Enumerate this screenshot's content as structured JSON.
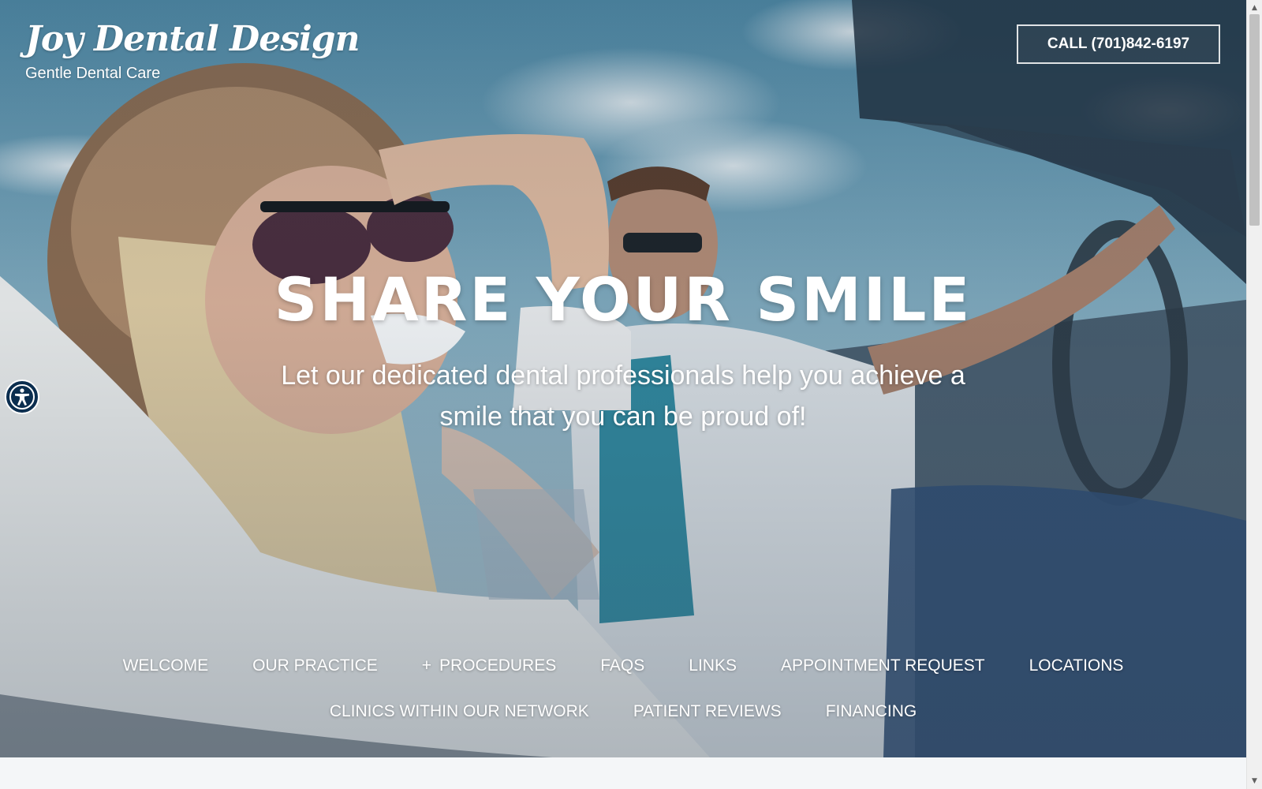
{
  "header": {
    "brand_name": "Joy Dental Design",
    "brand_tagline": "Gentle Dental Care",
    "call_button": "CALL (701)842-6197"
  },
  "hero": {
    "headline": "SHARE YOUR SMILE",
    "subhead": "Let our dedicated dental professionals help you achieve a smile that you can be proud of!"
  },
  "nav": {
    "row1": [
      {
        "label": "WELCOME"
      },
      {
        "label": "OUR PRACTICE"
      },
      {
        "label": "PROCEDURES",
        "prefix": "+"
      },
      {
        "label": "FAQS"
      },
      {
        "label": "LINKS"
      },
      {
        "label": "APPOINTMENT REQUEST"
      },
      {
        "label": "LOCATIONS"
      }
    ],
    "row2": [
      {
        "label": "CLINICS WITHIN OUR NETWORK"
      },
      {
        "label": "PATIENT REVIEWS"
      },
      {
        "label": "FINANCING"
      }
    ]
  },
  "accessibility": {
    "icon": "accessibility-icon"
  },
  "colors": {
    "accessibility_bg": "#0b2e4f",
    "text": "#ffffff",
    "page_bg": "#f4f6f8"
  }
}
